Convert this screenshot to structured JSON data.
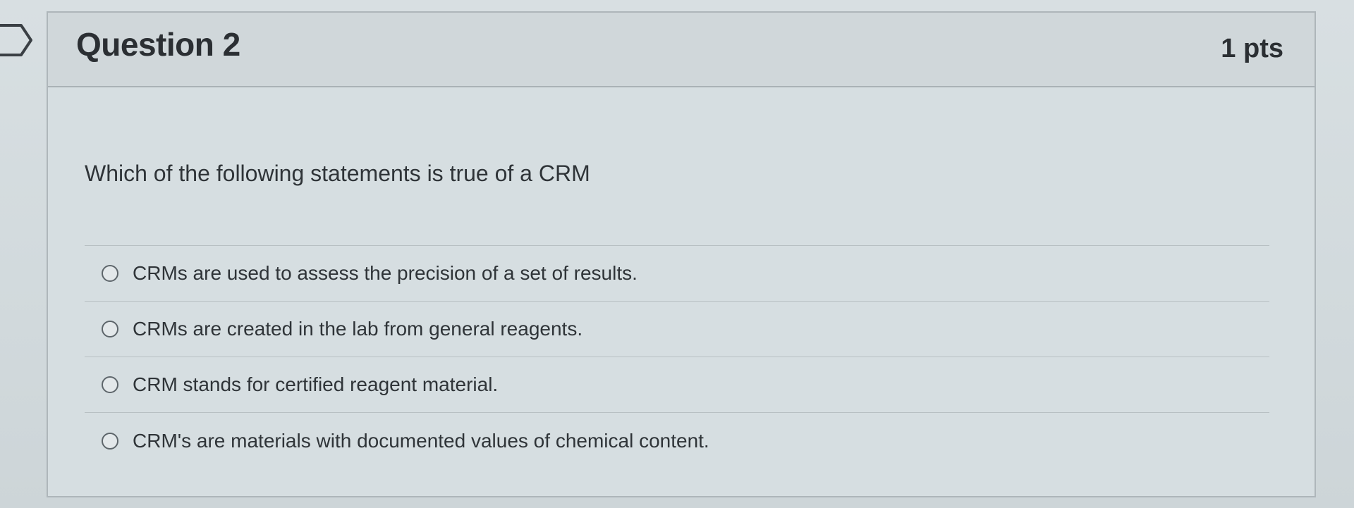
{
  "question": {
    "title": "Question 2",
    "points": "1 pts",
    "text": "Which of the following statements is true of a CRM",
    "answers": [
      {
        "label": "CRMs are used to assess the precision of a set of results."
      },
      {
        "label": "CRMs are created in the lab from general reagents."
      },
      {
        "label": "CRM stands for certified reagent material."
      },
      {
        "label": "CRM's are materials with documented values of chemical content."
      }
    ]
  },
  "icons": {
    "flag": "bookmark-flag-icon",
    "radio": "radio-circle-icon"
  },
  "colors": {
    "background": "#d5dde0",
    "header": "#d0d7da",
    "text": "#2f3438",
    "border": "#aeb6ba"
  }
}
